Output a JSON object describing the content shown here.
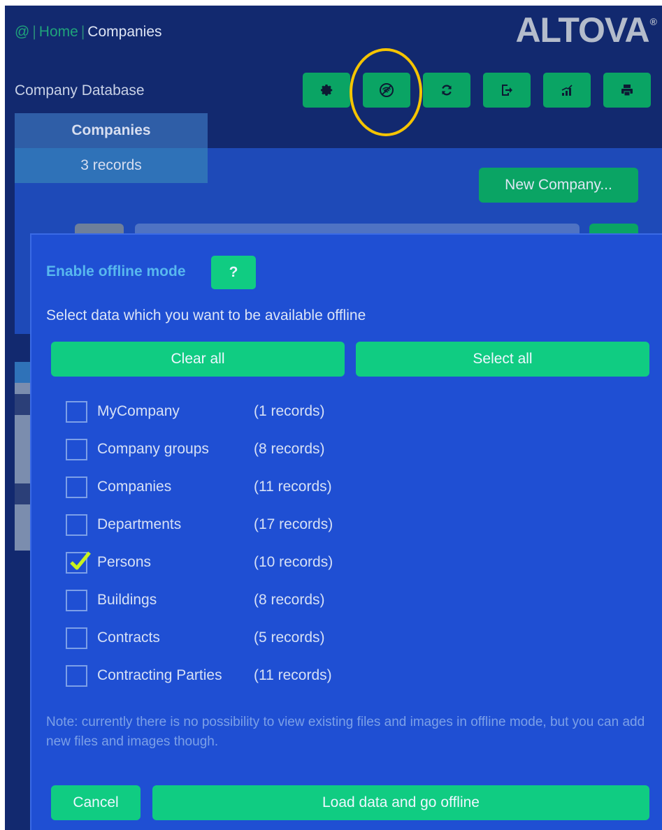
{
  "breadcrumb": {
    "at": "@",
    "home": "Home",
    "current": "Companies"
  },
  "logo": {
    "text": "ALTOVA",
    "mark": "®"
  },
  "header": {
    "db_title": "Company Database"
  },
  "toolbar": {
    "buttons": [
      {
        "icon": "gear-icon"
      },
      {
        "icon": "offline-icon",
        "highlighted": true
      },
      {
        "icon": "sync-icon"
      },
      {
        "icon": "export-icon"
      },
      {
        "icon": "chart-icon"
      },
      {
        "icon": "print-icon"
      }
    ]
  },
  "tab": {
    "title": "Companies",
    "count": "3 records"
  },
  "new_company_label": "New Company...",
  "dialog": {
    "title": "Enable offline mode",
    "help_label": "?",
    "subtitle": "Select data which you want to be available offline",
    "clear_all": "Clear all",
    "select_all": "Select all",
    "items": [
      {
        "name": "MyCompany",
        "count": "(1 records)",
        "checked": false
      },
      {
        "name": "Company groups",
        "count": "(8 records)",
        "checked": false
      },
      {
        "name": "Companies",
        "count": "(11 records)",
        "checked": false
      },
      {
        "name": "Departments",
        "count": "(17 records)",
        "checked": false
      },
      {
        "name": "Persons",
        "count": "(10 records)",
        "checked": true
      },
      {
        "name": "Buildings",
        "count": "(8 records)",
        "checked": false
      },
      {
        "name": "Contracts",
        "count": "(5 records)",
        "checked": false
      },
      {
        "name": "Contracting Parties",
        "count": "(11 records)",
        "checked": false
      }
    ],
    "note": "Note: currently there is no possibility to view existing files and images in offline mode, but you can add new files and images though.",
    "cancel": "Cancel",
    "go_offline": "Load data and go offline"
  },
  "colors": {
    "app_bg": "#12296f",
    "dialog_bg": "#1f4fd3",
    "accent_green": "#10cc82",
    "toolbar_green": "#0aa464",
    "highlight": "#f5c400",
    "checkmark": "#c8f21e"
  }
}
